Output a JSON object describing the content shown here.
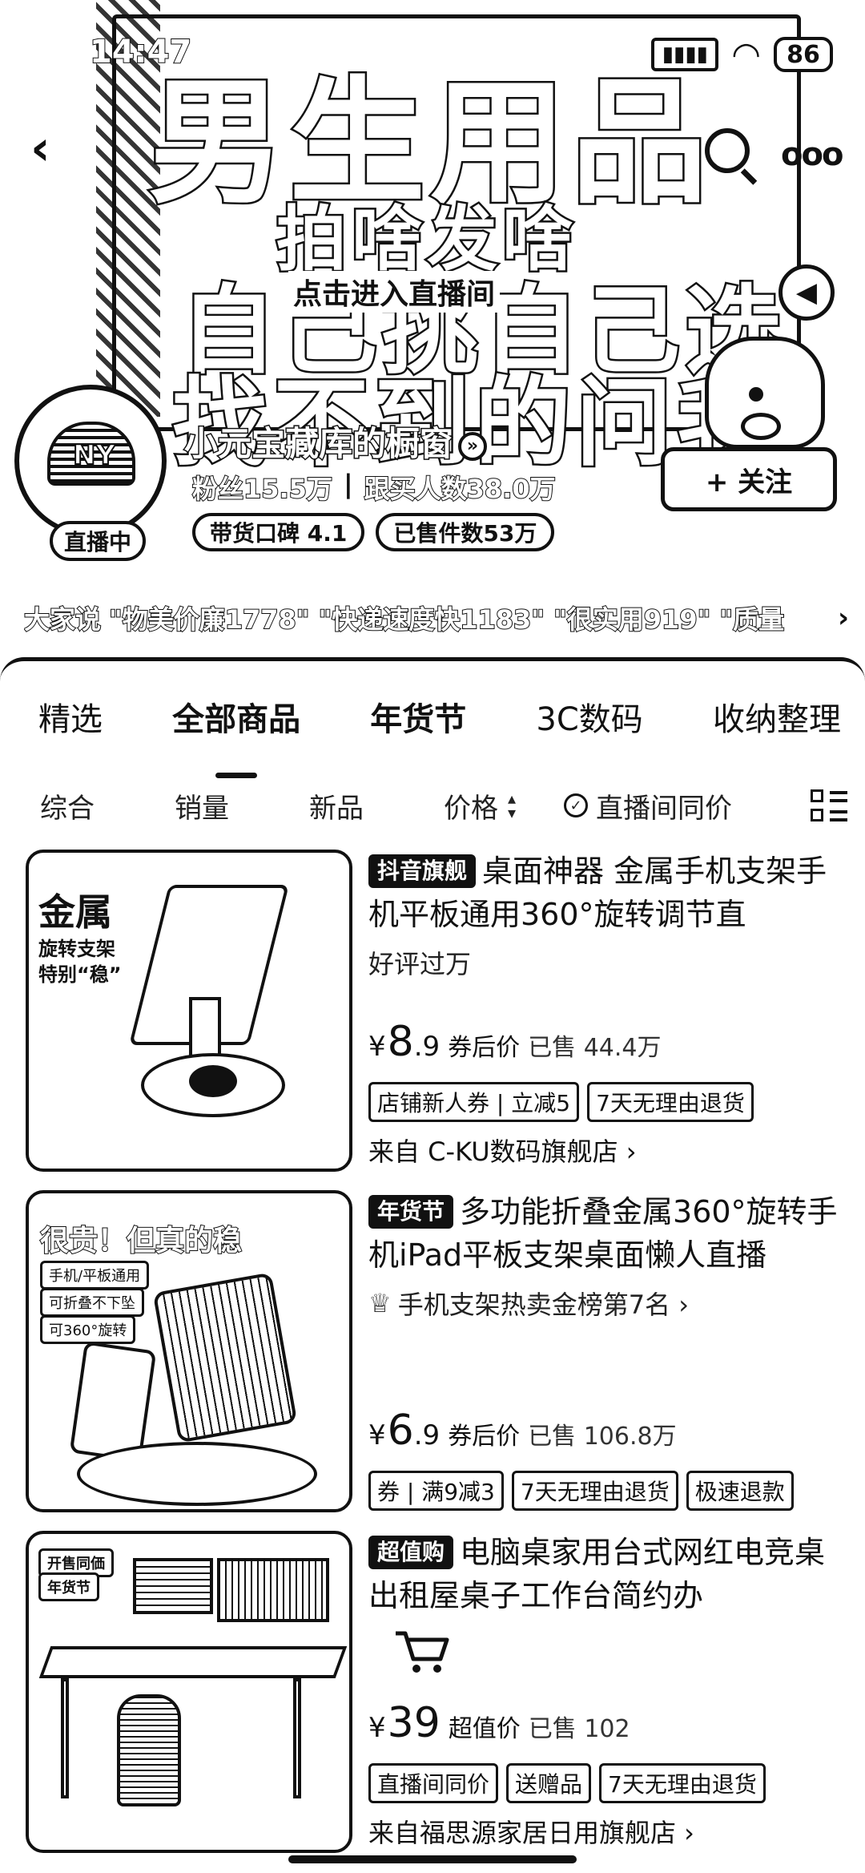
{
  "status_bar": {
    "time": "14:47",
    "battery": "86"
  },
  "banner": {
    "line1": "男生用品",
    "line2": "拍啥发啥",
    "line3": "自己挑自己选",
    "line4": "找不到的问我",
    "enter_live": "点击进入直播间"
  },
  "shop": {
    "name": "小元宝藏库的橱窗",
    "fans": "粉丝15.5万",
    "buyers": "跟买人数38.0万",
    "reputation": "带货口碑 4.1",
    "sold_count": "已售件数53万",
    "live_badge": "直播中",
    "follow_label": "+ 关注",
    "avatar_logo": "NY"
  },
  "reviews": {
    "lead": "大家说",
    "items": "\"物美价廉1778\" \"快递速度快1183\" \"很实用919\" \"质量"
  },
  "category_tabs": [
    {
      "label": "精选"
    },
    {
      "label": "全部商品"
    },
    {
      "label": "年货节"
    },
    {
      "label": "3C数码"
    },
    {
      "label": "收纳整理"
    }
  ],
  "sort_bar": {
    "items": [
      "综合",
      "销量",
      "新品",
      "价格"
    ],
    "same_price": "直播间同价"
  },
  "products": [
    {
      "badge": "抖音旗舰",
      "title": "桌面神器 金属手机支架手机平板通用360°旋转调节直",
      "subtitle": "好评过万",
      "price": "8",
      "price_decimal": ".9",
      "price_label": "券后价",
      "sold": "已售 44.4万",
      "tags": [
        "店铺新人券 | 立减5",
        "7天无理由退货"
      ],
      "from": "来自 C-KU数码旗舰店 ›",
      "thumb_text": {
        "a": "金属",
        "b": "旋转支架",
        "c": "特别“稳”"
      }
    },
    {
      "badge": "年货节",
      "title": "多功能折叠金属360°旋转手机iPad平板支架桌面懒人直播",
      "subtitle": "手机支架热卖金榜第7名 ›",
      "price": "6",
      "price_decimal": ".9",
      "price_label": "券后价",
      "sold": "已售 106.8万",
      "tags": [
        "券 | 满9减3",
        "7天无理由退货",
        "极速退款"
      ],
      "thumb_text": {
        "a": "很贵！但真的稳",
        "b": "手机/平板通用",
        "c": "可折叠不下坠",
        "d": "可360°旋转"
      }
    },
    {
      "badge": "超值购",
      "title": "电脑桌家用台式网红电竞桌出租屋桌子工作台简约办",
      "price": "39",
      "price_label": "超值价",
      "sold": "已售 102",
      "tags": [
        "直播间同价",
        "送赠品",
        "7天无理由退货"
      ],
      "from": "来自福思源家居日用旗舰店 ›",
      "thumb_text": {
        "a": "开售同価",
        "b": "年货节"
      }
    }
  ],
  "icons": {
    "back": "chevron-left-icon",
    "search": "search-icon",
    "more": "more-icon",
    "mute": "speaker-icon",
    "cart": "cart-icon",
    "layout": "grid-view-icon"
  }
}
